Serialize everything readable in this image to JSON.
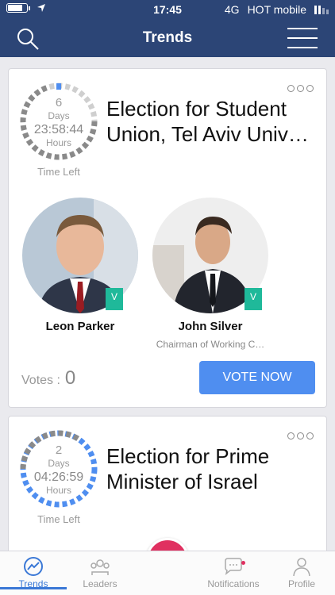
{
  "status_bar": {
    "time": "17:45",
    "network": "4G",
    "carrier": "HOT mobile"
  },
  "header": {
    "title": "Trends",
    "search_icon": "search-icon",
    "menu_icon": "menu-icon"
  },
  "colors": {
    "header_bg": "#2c4576",
    "accent": "#4f8ef0",
    "verified": "#1fb99a",
    "fab": "#e03060"
  },
  "elections": [
    {
      "countdown": {
        "days": "6",
        "days_label": "Days",
        "clock": "23:58:44",
        "hours_label": "Hours",
        "time_left_label": "Time Left"
      },
      "title": "Election for Student Union, Tel Aviv Univ…",
      "candidates": [
        {
          "name": "Leon Parker",
          "subtitle": "",
          "verified_badge": "V"
        },
        {
          "name": "John Silver",
          "subtitle": "Chairman of Working C…",
          "verified_badge": "V"
        }
      ],
      "votes_label": "Votes :",
      "votes_count": "0",
      "vote_button": "VOTE NOW"
    },
    {
      "countdown": {
        "days": "2",
        "days_label": "Days",
        "clock": "04:26:59",
        "hours_label": "Hours",
        "time_left_label": "Time Left"
      },
      "title": "Election for Prime Minister of Israel"
    }
  ],
  "tabs": [
    {
      "label": "Trends",
      "icon": "trends-icon"
    },
    {
      "label": "Leaders",
      "icon": "leaders-icon"
    },
    {
      "label": "",
      "icon": "vote-hand-icon"
    },
    {
      "label": "Notifications",
      "icon": "notifications-icon"
    },
    {
      "label": "Profile",
      "icon": "profile-icon"
    }
  ]
}
